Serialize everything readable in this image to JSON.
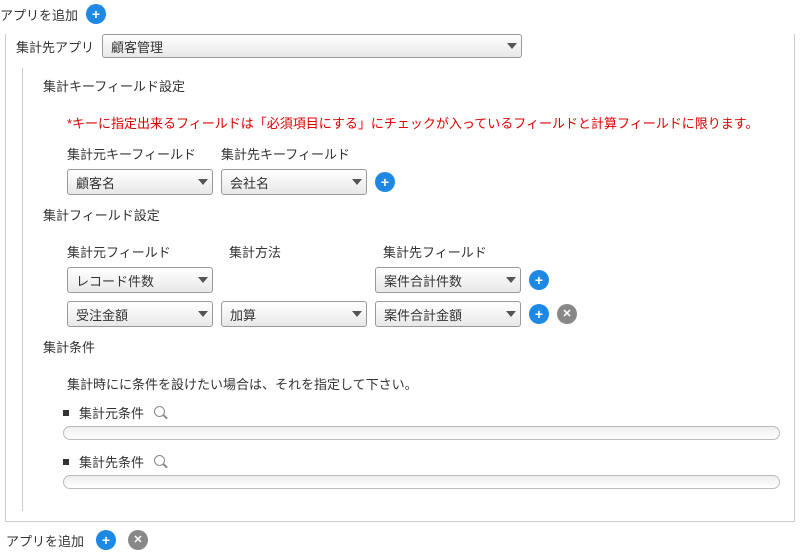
{
  "header": {
    "add_app_label": "アプリを追加"
  },
  "target_app": {
    "label": "集計先アプリ",
    "selected": "顧客管理"
  },
  "key_section": {
    "title": "集計キーフィールド設定",
    "warn": "*キーに指定出来るフィールドは「必須項目にする」にチェックが入っているフィールドと計算フィールドに限ります。",
    "src_label": "集計元キーフィールド",
    "dst_label": "集計先キーフィールド",
    "rows": [
      {
        "src": "顧客名",
        "dst": "会社名"
      }
    ]
  },
  "agg_section": {
    "title": "集計フィールド設定",
    "src_label": "集計元フィールド",
    "method_label": "集計方法",
    "dst_label": "集計先フィールド",
    "rows": [
      {
        "src": "レコード件数",
        "method": "",
        "dst": "案件合計件数",
        "has_remove": false
      },
      {
        "src": "受注金額",
        "method": "加算",
        "dst": "案件合計金額",
        "has_remove": true
      }
    ]
  },
  "cond_section": {
    "title": "集計条件",
    "desc": "集計時にに条件を設けたい場合は、それを指定して下さい。",
    "src_cond_label": "集計元条件",
    "dst_cond_label": "集計先条件"
  },
  "footer": {
    "add_app_label": "アプリを追加"
  }
}
